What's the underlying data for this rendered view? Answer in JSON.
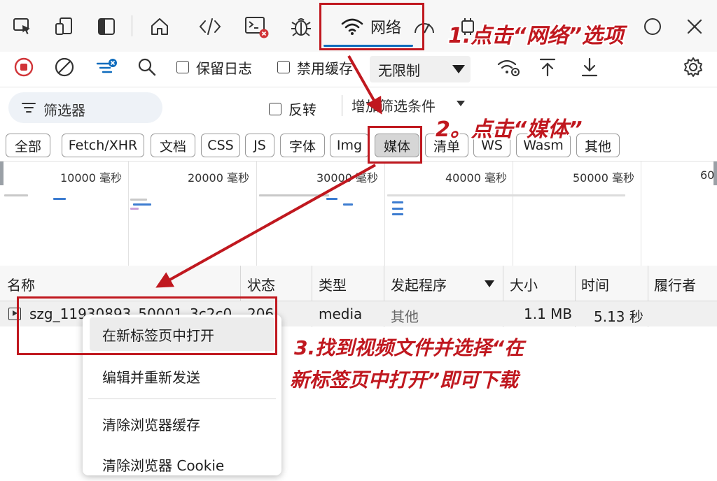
{
  "tabs": {
    "network_label": "网络"
  },
  "toolbar": {
    "preserve_log_label": "保留日志",
    "disable_cache_label": "禁用缓存",
    "throttling_value": "无限制"
  },
  "filter": {
    "placeholder": "筛选器",
    "invert_label": "反转",
    "more_filters_label": "增加筛选条件"
  },
  "type_filters": [
    "全部",
    "Fetch/XHR",
    "文档",
    "CSS",
    "JS",
    "字体",
    "Img",
    "媒体",
    "清单",
    "WS",
    "Wasm",
    "其他"
  ],
  "active_type_filter": "媒体",
  "overview": {
    "ticks": [
      "10000 毫秒",
      "20000 毫秒",
      "30000 毫秒",
      "40000 毫秒",
      "50000 毫秒",
      "60"
    ]
  },
  "table": {
    "columns": [
      "名称",
      "状态",
      "类型",
      "发起程序",
      "大小",
      "时间",
      "履行者"
    ],
    "rows": [
      {
        "name": "szg_11930893_50001_3c2c0",
        "status": "206",
        "type": "media",
        "initiator": "其他",
        "size": "1.1 MB",
        "time": "5.13 秒",
        "fulfilled_by": ""
      }
    ]
  },
  "context_menu": {
    "items": [
      "在新标签页中打开",
      "编辑并重新发送",
      "清除浏览器缓存",
      "清除浏览器 Cookie"
    ]
  },
  "annotations": {
    "step1": "1.点击“网络”选项",
    "step2": "2。点击“媒体”",
    "step3_line1": "3.找到视频文件并选择“在",
    "step3_line2": "新标签页中打开”即可下载"
  },
  "colors": {
    "accent": "#0f6cbd",
    "annotation_red": "#c0181f",
    "record_red": "#d13438"
  }
}
